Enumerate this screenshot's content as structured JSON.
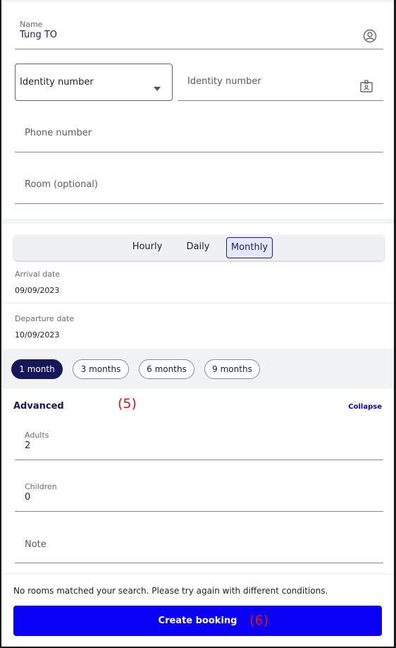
{
  "name_field": {
    "label": "Name",
    "value": "Tung TO"
  },
  "identity_type": {
    "selected": "Identity number"
  },
  "identity_number": {
    "placeholder": "Identity number"
  },
  "phone": {
    "placeholder": "Phone number"
  },
  "room": {
    "placeholder": "Room (optional)"
  },
  "rate_tabs": [
    {
      "label": "Hourly"
    },
    {
      "label": "Daily"
    },
    {
      "label": "Monthly"
    }
  ],
  "arrival": {
    "label": "Arrival date",
    "value": "09/09/2023"
  },
  "departure": {
    "label": "Departure date",
    "value": "10/09/2023"
  },
  "durations": [
    {
      "label": "1 month",
      "selected": true
    },
    {
      "label": "3 months",
      "selected": false
    },
    {
      "label": "6 months",
      "selected": false
    },
    {
      "label": "9 months",
      "selected": false
    }
  ],
  "advanced": {
    "title": "Advanced",
    "toggle": "Collapse"
  },
  "annotations": {
    "a5": "(5)",
    "a6": "(6)"
  },
  "adults": {
    "label": "Adults",
    "value": "2"
  },
  "children": {
    "label": "Children",
    "value": "0"
  },
  "note": {
    "placeholder": "Note"
  },
  "message": "No rooms matched your search. Please try again with different conditions.",
  "submit_label": "Create booking",
  "colors": {
    "primary": "#0a00f5",
    "navy": "#16165c",
    "annotation": "#e01414"
  }
}
